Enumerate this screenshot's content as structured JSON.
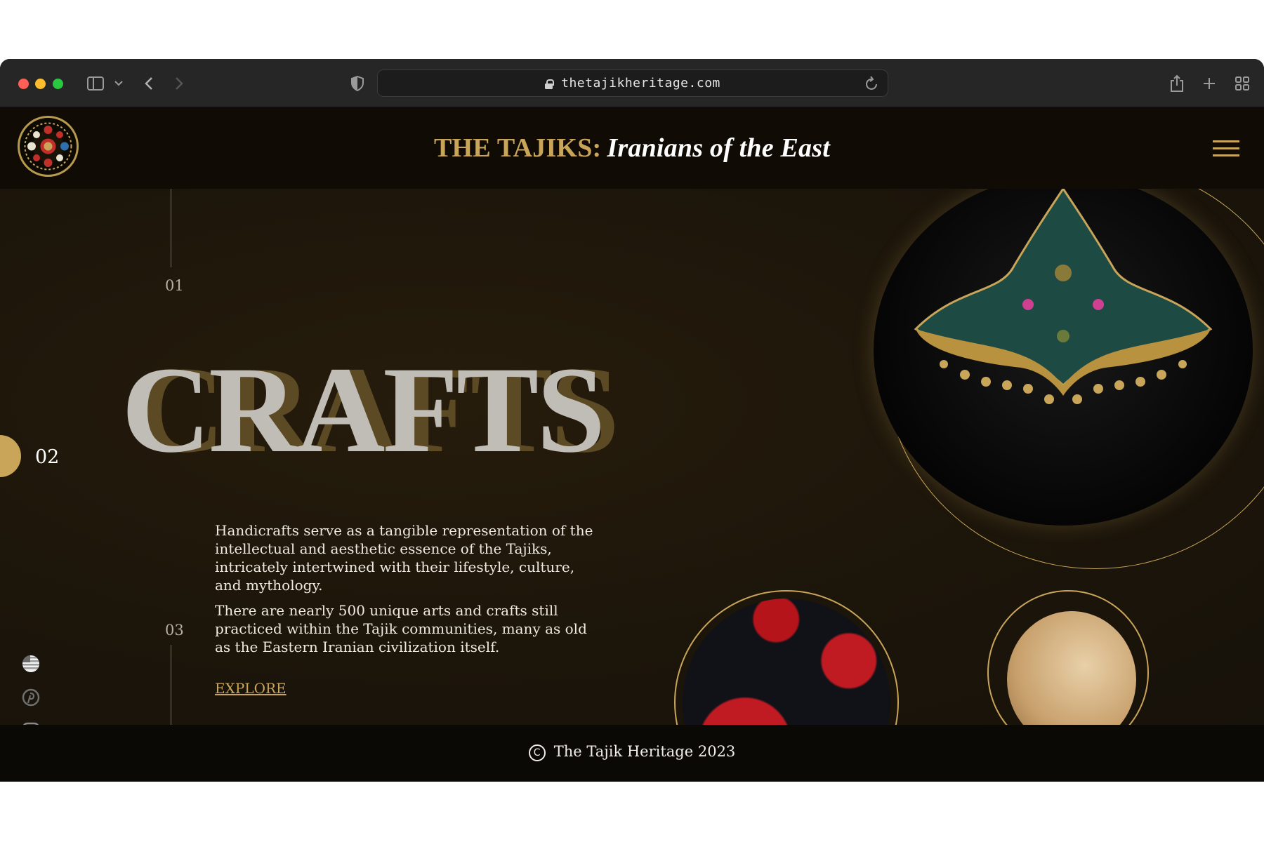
{
  "browser": {
    "url": "thetajikheritage.com"
  },
  "header": {
    "title_prefix": "THE TAJIKS:",
    "title_suffix": "Iranians of the East"
  },
  "sections": {
    "n1": "01",
    "n2": "02",
    "n3": "03"
  },
  "hero": {
    "word": "CRAFTS",
    "paragraph1": "Handicrafts serve as a tangible representation of the intellectual and aesthetic essence of the Tajiks, intricately intertwined with their lifestyle, culture, and mythology.",
    "paragraph2": "There are nearly 500 unique arts and crafts still practiced within the Tajik communities, many as old as the Eastern Iranian civilization itself.",
    "cta": "EXPLORE"
  },
  "social": [
    "language-flag-icon",
    "pinterest-icon",
    "instagram-icon",
    "gmail-icon"
  ],
  "footer": {
    "symbol": "C",
    "text": "The Tajik Heritage 2023"
  },
  "colors": {
    "gold": "#c9a55a",
    "background": "#17120a",
    "header_bg": "#100c05"
  }
}
